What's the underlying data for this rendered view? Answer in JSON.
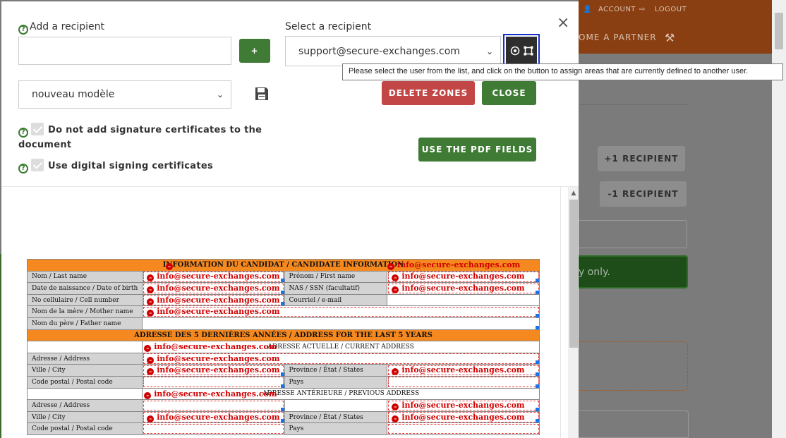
{
  "background": {
    "account": "ACCOUNT",
    "logout": "LOGOUT",
    "nav_partner": "OME A PARTNER",
    "add_recipient_btn": "+1 RECIPIENT",
    "remove_recipient_btn": "-1 RECIPIENT",
    "alert_text": "y only.",
    "colors": {
      "header": "#8a3f12",
      "overlay": "#7a7a7a"
    }
  },
  "modal": {
    "add_recipient_label": "Add a recipient",
    "add_recipient_value": "",
    "add_button": "+",
    "select_recipient_label": "Select a recipient",
    "select_recipient_value": "support@secure-exchanges.com",
    "template_value": "nouveau modèle",
    "tooltip": "Please select the user from the list, and click on the button to assign areas that are currently defined to another user.",
    "delete_zones": "DELETE ZONES",
    "close": "CLOSE",
    "use_pdf_fields": "USE THE PDF FIELDS",
    "chk_no_signature": "Do not add signature certificates to the document",
    "chk_digital_signing": "Use digital signing certificates",
    "close_icon": "×",
    "help_icon": "?",
    "colors": {
      "green": "#3f7b35",
      "red": "#c24646",
      "highlight": "#1530c8"
    }
  },
  "pdf": {
    "zone_email": "info@secure-exchanges.com",
    "candidate_header": "INFORMATION DU CANDIDAT / CANDIDATE INFORMATION",
    "last_name": "Nom / Last name",
    "first_name": "Prénom / First name",
    "dob": "Date de naissance / Date of birth",
    "sin": "NAS / SSN (facultatif)",
    "cell": "No cellulaire / Cell number",
    "email": "Courriel / e-mail",
    "mother": "Nom de la mère / Mother name",
    "father": "Nom du père / Father name",
    "address_header": "ADRESSE DES 5 DERNIÈRES ANNÉES / ADDRESS FOR THE LAST 5 YEARS",
    "current_address": "ADRESSE ACTUELLE / CURRENT ADDRESS",
    "previous_address": "ADRESSE ANTÉRIEURE / PREVIOUS ADDRESS",
    "address": "Adresse / Address",
    "city": "Ville / City",
    "province": "Province / État / States",
    "postal": "Code postal / Postal code",
    "country": "Pays",
    "zone_color": "#d10000",
    "header_color": "#f5891f"
  }
}
